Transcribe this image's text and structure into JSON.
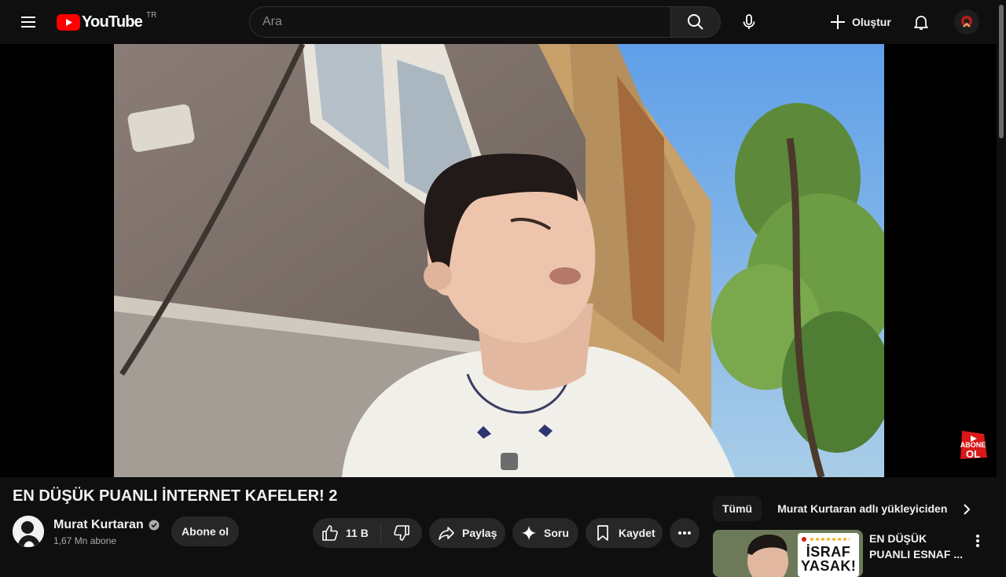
{
  "header": {
    "logo_text": "YouTube",
    "country_code": "TR",
    "search_placeholder": "Ara",
    "create_label": "Oluştur"
  },
  "video": {
    "title": "EN DÜŞÜK PUANLI İNTERNET KAFELER! 2",
    "subscribe_badge_line1": "ABONE",
    "subscribe_badge_line2": "OL"
  },
  "channel": {
    "name": "Murat Kurtaran",
    "subscribers": "1,67 Mn abone",
    "verified": true,
    "subscribe_label": "Abone ol"
  },
  "actions": {
    "like_count": "11 B",
    "share_label": "Paylaş",
    "ask_label": "Soru",
    "save_label": "Kaydet"
  },
  "filters": {
    "chips": [
      "Tümü",
      "Murat Kurtaran adlı yükleyiciden"
    ]
  },
  "recommendations": [
    {
      "title": "EN DÜŞÜK PUANLI ESNAF ...",
      "thumb_text_line1": "İSRAF",
      "thumb_text_line2": "YASAK!"
    }
  ],
  "colors": {
    "background": "#0f0f0f",
    "brand_red": "#ff0000",
    "pill": "#272727",
    "secondary_text": "#aaaaaa"
  }
}
